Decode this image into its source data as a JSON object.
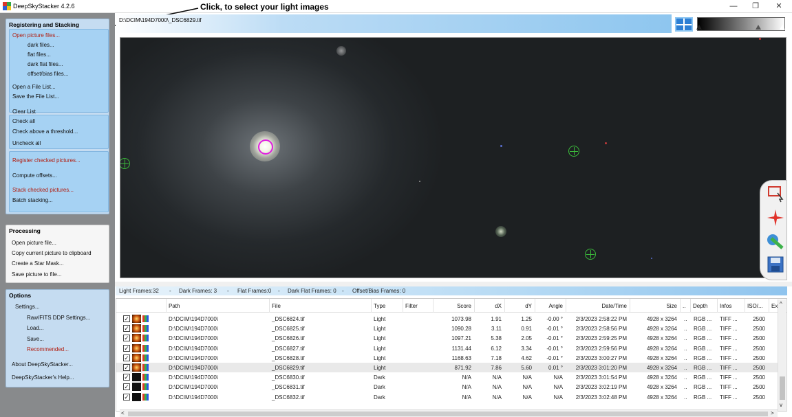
{
  "window": {
    "title": "DeepSkyStacker 4.2.6",
    "annotation": "Click, to select your light images",
    "controls": [
      "—",
      "❐",
      "✕"
    ]
  },
  "sidebar": {
    "registering": {
      "title": "Registering and Stacking",
      "open_picture_files": "Open picture files...",
      "dark_files": "dark files...",
      "flat_files": "flat files...",
      "dark_flat_files": "dark flat files...",
      "offset_bias_files": "offset/bias files...",
      "open_file_list": "Open a File List...",
      "save_file_list": "Save the File List...",
      "clear_list": "Clear List",
      "check_all": "Check all",
      "check_above_threshold": "Check above a threshold...",
      "uncheck_all": "Uncheck all",
      "register_checked": "Register checked pictures...",
      "compute_offsets": "Compute offsets...",
      "stack_checked": "Stack checked pictures...",
      "batch_stacking": "Batch stacking..."
    },
    "processing": {
      "title": "Processing",
      "open_picture_file": "Open picture file...",
      "copy_clipboard": "Copy current picture to clipboard",
      "create_star_mask": "Create a Star Mask...",
      "save_picture": "Save picture to file..."
    },
    "options": {
      "title": "Options",
      "settings": "Settings...",
      "raw_fits": "Raw/FITS DDP Settings...",
      "load": "Load...",
      "save": "Save...",
      "recommended": "Recommended...",
      "about": "About DeepSkyStacker...",
      "help": "DeepSkyStacker's Help..."
    }
  },
  "image": {
    "path": "D:\\DCIM\\194D7000\\_DSC6829.tif"
  },
  "frames": {
    "light": "Light Frames:32",
    "dark": "Dark Frames: 3",
    "flat": "Flat Frames:0",
    "dark_flat": "Dark Flat Frames: 0",
    "offset": "Offset/Bias Frames: 0",
    "sep": "-"
  },
  "table": {
    "headers": {
      "path": "Path",
      "file": "File",
      "type": "Type",
      "filter": "Filter",
      "score": "Score",
      "dx": "dX",
      "dy": "dY",
      "angle": "Angle",
      "datetime": "Date/Time",
      "size": "Size",
      "dots": "..",
      "depth": "Depth",
      "infos": "Infos",
      "iso": "ISO/...",
      "ex": "Ex"
    },
    "rows": [
      {
        "path": "D:\\DCIM\\194D7000\\",
        "file": "_DSC6824.tif",
        "type": "Light",
        "score": "1073.98",
        "dx": "1.91",
        "dy": "1.25",
        "angle": "-0.00 °",
        "datetime": "2/3/2023 2:58:22 PM",
        "size": "4928 x 3264",
        "dots": "..",
        "depth": "RGB ...",
        "infos": "TIFF ...",
        "iso": "2500"
      },
      {
        "path": "D:\\DCIM\\194D7000\\",
        "file": "_DSC6825.tif",
        "type": "Light",
        "score": "1090.28",
        "dx": "3.11",
        "dy": "0.91",
        "angle": "-0.01 °",
        "datetime": "2/3/2023 2:58:56 PM",
        "size": "4928 x 3264",
        "dots": "..",
        "depth": "RGB ...",
        "infos": "TIFF ...",
        "iso": "2500"
      },
      {
        "path": "D:\\DCIM\\194D7000\\",
        "file": "_DSC6826.tif",
        "type": "Light",
        "score": "1097.21",
        "dx": "5.38",
        "dy": "2.05",
        "angle": "-0.01 °",
        "datetime": "2/3/2023 2:59:25 PM",
        "size": "4928 x 3264",
        "dots": "..",
        "depth": "RGB ...",
        "infos": "TIFF ...",
        "iso": "2500"
      },
      {
        "path": "D:\\DCIM\\194D7000\\",
        "file": "_DSC6827.tif",
        "type": "Light",
        "score": "1131.44",
        "dx": "6.12",
        "dy": "3.34",
        "angle": "-0.01 °",
        "datetime": "2/3/2023 2:59:56 PM",
        "size": "4928 x 3264",
        "dots": "..",
        "depth": "RGB ...",
        "infos": "TIFF ...",
        "iso": "2500"
      },
      {
        "path": "D:\\DCIM\\194D7000\\",
        "file": "_DSC6828.tif",
        "type": "Light",
        "score": "1168.63",
        "dx": "7.18",
        "dy": "4.62",
        "angle": "-0.01 °",
        "datetime": "2/3/2023 3:00:27 PM",
        "size": "4928 x 3264",
        "dots": "..",
        "depth": "RGB ...",
        "infos": "TIFF ...",
        "iso": "2500"
      },
      {
        "path": "D:\\DCIM\\194D7000\\",
        "file": "_DSC6829.tif",
        "type": "Light",
        "score": "871.92",
        "dx": "7.86",
        "dy": "5.60",
        "angle": "0.01 °",
        "datetime": "2/3/2023 3:01:20 PM",
        "size": "4928 x 3264",
        "dots": "..",
        "depth": "RGB ...",
        "infos": "TIFF ...",
        "iso": "2500"
      },
      {
        "path": "D:\\DCIM\\194D7000\\",
        "file": "_DSC6830.tif",
        "type": "Dark",
        "score": "N/A",
        "dx": "N/A",
        "dy": "N/A",
        "angle": "N/A",
        "datetime": "2/3/2023 3:01:54 PM",
        "size": "4928 x 3264",
        "dots": "..",
        "depth": "RGB ...",
        "infos": "TIFF ...",
        "iso": "2500"
      },
      {
        "path": "D:\\DCIM\\194D7000\\",
        "file": "_DSC6831.tif",
        "type": "Dark",
        "score": "N/A",
        "dx": "N/A",
        "dy": "N/A",
        "angle": "N/A",
        "datetime": "2/3/2023 3:02:19 PM",
        "size": "4928 x 3264",
        "dots": "..",
        "depth": "RGB ...",
        "infos": "TIFF ...",
        "iso": "2500"
      },
      {
        "path": "D:\\DCIM\\194D7000\\",
        "file": "_DSC6832.tif",
        "type": "Dark",
        "score": "N/A",
        "dx": "N/A",
        "dy": "N/A",
        "angle": "N/A",
        "datetime": "2/3/2023 3:02:48 PM",
        "size": "4928 x 3264",
        "dots": "..",
        "depth": "RGB ...",
        "infos": "TIFF ...",
        "iso": "2500"
      }
    ]
  },
  "scroll": {
    "left": "<",
    "right": ">",
    "up": "^",
    "down": "v"
  },
  "colors": {
    "accent_red": "#b21c0e",
    "panel_blue": "#a6d2f3",
    "select_mark": "#e01ee0",
    "star_mark": "#3bbd3b"
  },
  "icons": [
    "app-icon",
    "grid-icon",
    "histogram-icon",
    "select-rect-icon",
    "star-edit-icon",
    "comet-icon",
    "save-icon"
  ]
}
